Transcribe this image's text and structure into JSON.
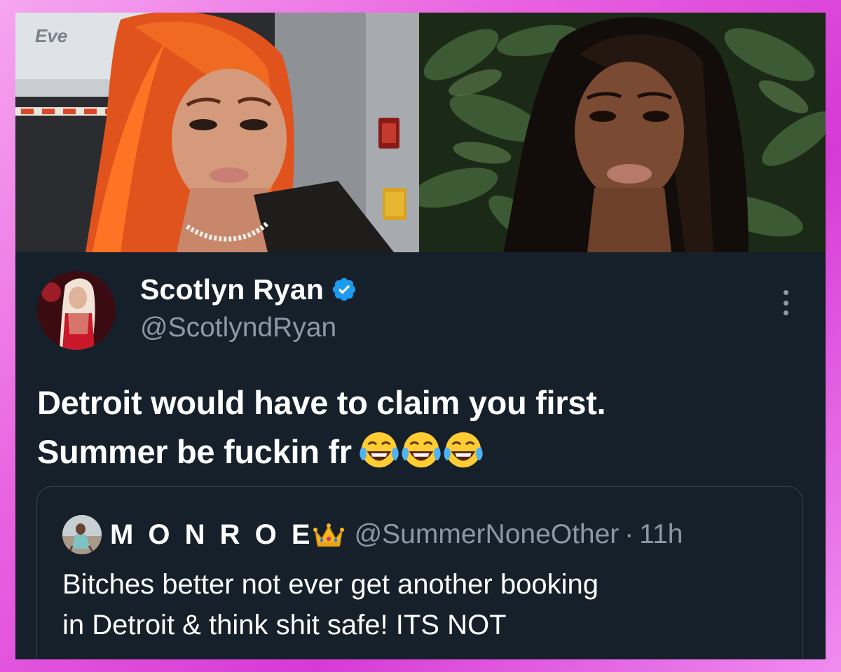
{
  "photos": {
    "left_sign_text": "Eve",
    "left_alt": "photo-left",
    "right_alt": "photo-right"
  },
  "tweet": {
    "display_name": "Scotlyn Ryan",
    "handle": "@ScotlyndRyan",
    "verified": true,
    "text_line_1": "Detroit would have to claim you first.",
    "text_line_2": "Summer be fuckin fr",
    "emoji": "face-with-tears-of-joy",
    "emoji_count": 3,
    "more_icon": "more-vertical-icon"
  },
  "quoted_tweet": {
    "display_name": "M O N R O E",
    "crown_icon": "crown-icon",
    "handle": "@SummerNoneOther",
    "separator": "·",
    "time": "11h",
    "text_line_1": "Bitches better not ever get another booking",
    "text_line_2": "in Detroit & think shit safe! ITS NOT"
  },
  "colors": {
    "card_bg": "#15202b",
    "text_primary": "#ffffff",
    "text_secondary": "#8b98a5",
    "verified_blue": "#1d9bf0",
    "border": "#38444d",
    "frame_pink": "#e860e0"
  }
}
